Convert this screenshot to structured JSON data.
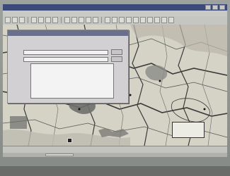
{
  "window": {
    "title": "",
    "menu": ""
  },
  "dialog": {
    "title": "",
    "instructions": "",
    "from_label": "",
    "from_value": "",
    "to_label": "",
    "to_value": "",
    "ok_label": "",
    "cancel_label": "",
    "list_items": [
      "",
      "",
      "",
      "",
      ""
    ]
  },
  "map": {
    "callout": "",
    "legend_text": ""
  },
  "statusbar": {
    "text": ""
  },
  "colors": {
    "titlebar": "#3b4a78",
    "dialog": "#d2d0d3",
    "map_land": "#d5d3c6",
    "road": "#3a3a3a"
  }
}
